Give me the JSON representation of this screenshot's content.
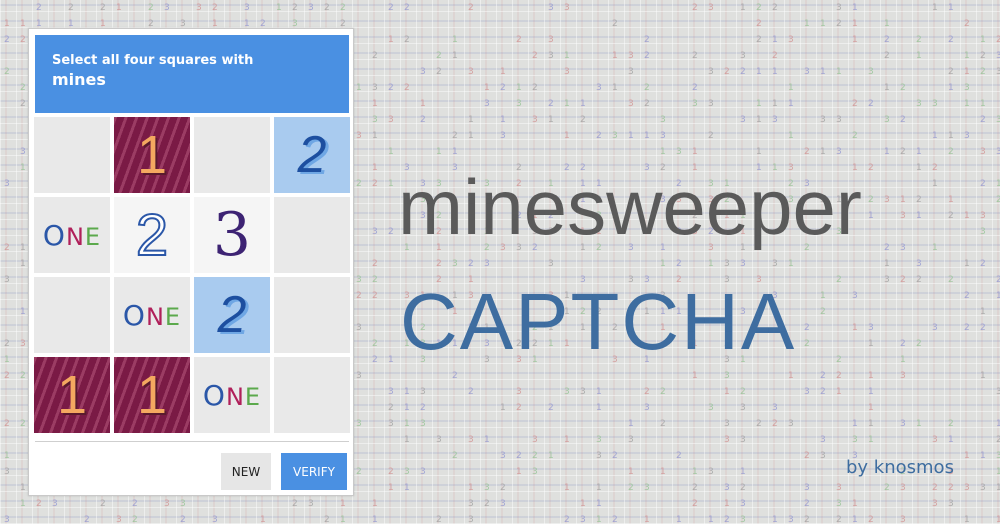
{
  "header": {
    "line1": "Select all four squares with",
    "line2": "mines"
  },
  "tiles": [
    {
      "style": "plain",
      "glyph": ""
    },
    {
      "style": "maroon",
      "glyph": "1"
    },
    {
      "style": "plain",
      "glyph": ""
    },
    {
      "style": "light",
      "glyph": "2"
    },
    {
      "style": "plain",
      "glyph": "ONE"
    },
    {
      "style": "white",
      "glyph": "2"
    },
    {
      "style": "white",
      "glyph": "3"
    },
    {
      "style": "plain",
      "glyph": ""
    },
    {
      "style": "plain",
      "glyph": ""
    },
    {
      "style": "plain",
      "glyph": "ONE"
    },
    {
      "style": "light",
      "glyph": "2"
    },
    {
      "style": "plain",
      "glyph": ""
    },
    {
      "style": "maroon",
      "glyph": "1"
    },
    {
      "style": "maroon",
      "glyph": "1"
    },
    {
      "style": "plain",
      "glyph": "ONE"
    },
    {
      "style": "plain",
      "glyph": ""
    }
  ],
  "buttons": {
    "new": "NEW",
    "verify": "VERIFY"
  },
  "title": {
    "line1": "minesweeper",
    "line2": "CAPTCHA"
  },
  "byline": "by knosmos",
  "colors": {
    "accent": "#4a90e2",
    "title_gray": "#5a5a5a",
    "title_blue": "#3e6da0",
    "maroon": "#7a1a45"
  }
}
